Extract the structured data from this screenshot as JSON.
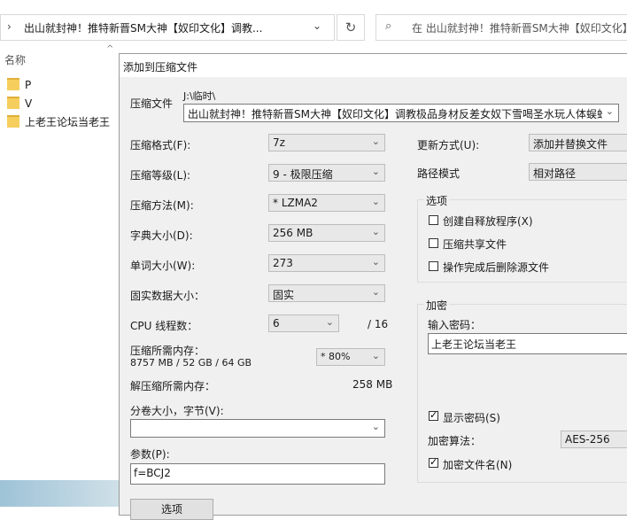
{
  "explorer": {
    "address_path": "出山就封神！推特新晋SM大神【奴印文化】调教...",
    "search_placeholder": "在 出山就封神！推特新晋SM大神【奴印文化】",
    "column_name": "名称",
    "folders": [
      "P",
      "V",
      "上老王论坛当老王"
    ]
  },
  "dialog": {
    "title": "添加到压缩文件",
    "archive": {
      "label": "压缩文件",
      "dir": "J:\\临时\\",
      "name": "出山就封神！推特新晋SM大神【奴印文化】调教极品身材反差女奴下雪喝圣水玩人体蜈蚣"
    },
    "format": {
      "label": "压缩格式(F):",
      "value": "7z"
    },
    "level": {
      "label": "压缩等级(L):",
      "value": "9 - 极限压缩"
    },
    "method": {
      "label": "压缩方法(M):",
      "value": "*  LZMA2"
    },
    "dict": {
      "label": "字典大小(D):",
      "value": "256 MB"
    },
    "word": {
      "label": "单词大小(W):",
      "value": "273"
    },
    "solid": {
      "label": "固实数据大小：",
      "value": "固实"
    },
    "threads": {
      "label": "CPU 线程数：",
      "value": "6",
      "max": "/ 16"
    },
    "mem_comp": {
      "label": "压缩所需内存：",
      "detail": "8757 MB / 52 GB / 64 GB",
      "percent": "* 80%"
    },
    "mem_decomp": {
      "label": "解压缩所需内存：",
      "value": "258 MB"
    },
    "volume": {
      "label": "分卷大小，字节(V):",
      "value": ""
    },
    "params": {
      "label": "参数(P):",
      "value": "f=BCJ2"
    },
    "partial_button": "选项",
    "update": {
      "label": "更新方式(U):",
      "value": "添加并替换文件"
    },
    "path_mode": {
      "label": "路径模式",
      "value": "相对路径"
    },
    "options": {
      "title": "选项",
      "sfx": "创建自释放程序(X)",
      "shared": "压缩共享文件",
      "delete_after": "操作完成后删除源文件"
    },
    "encryption": {
      "title": "加密",
      "password_label": "输入密码：",
      "password_value": "上老王论坛当老王",
      "show_password": "显示密码(S)",
      "method_label": "加密算法：",
      "method_value": "AES-256",
      "encrypt_names": "加密文件名(N)"
    }
  }
}
